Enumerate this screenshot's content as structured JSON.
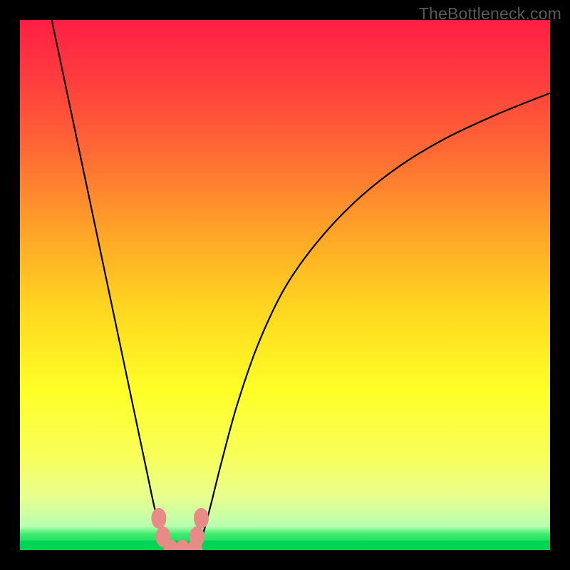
{
  "watermark": "TheBottleneck.com",
  "colors": {
    "frame": "#000000",
    "curve_stroke": "#000000",
    "marker_fill": "#e88a85",
    "marker_stroke": "#e88a85",
    "green_band": "#00d455",
    "gradient_stops": [
      {
        "offset": 0.0,
        "color": "#ff1e45"
      },
      {
        "offset": 0.12,
        "color": "#ff3f3e"
      },
      {
        "offset": 0.25,
        "color": "#ff6a34"
      },
      {
        "offset": 0.4,
        "color": "#ffa428"
      },
      {
        "offset": 0.55,
        "color": "#ffd81f"
      },
      {
        "offset": 0.7,
        "color": "#ffff27"
      },
      {
        "offset": 0.82,
        "color": "#f8ff58"
      },
      {
        "offset": 0.9,
        "color": "#e8ff8e"
      },
      {
        "offset": 0.955,
        "color": "#b8ffb0"
      },
      {
        "offset": 0.97,
        "color": "#3eea6e"
      },
      {
        "offset": 1.0,
        "color": "#00d455"
      }
    ]
  },
  "chart_data": {
    "type": "line",
    "title": "",
    "xlabel": "",
    "ylabel": "",
    "xlim": [
      0,
      1
    ],
    "ylim": [
      0,
      1
    ],
    "series": [
      {
        "name": "left-curve",
        "x": [
          0.06,
          0.08,
          0.1,
          0.12,
          0.14,
          0.16,
          0.18,
          0.2,
          0.22,
          0.24,
          0.255,
          0.268,
          0.278,
          0.285
        ],
        "y": [
          1.0,
          0.905,
          0.81,
          0.715,
          0.62,
          0.525,
          0.43,
          0.335,
          0.24,
          0.145,
          0.075,
          0.03,
          0.01,
          0.0
        ]
      },
      {
        "name": "right-curve",
        "x": [
          0.33,
          0.345,
          0.36,
          0.38,
          0.41,
          0.45,
          0.5,
          0.56,
          0.63,
          0.71,
          0.8,
          0.9,
          1.0
        ],
        "y": [
          0.0,
          0.03,
          0.085,
          0.165,
          0.275,
          0.39,
          0.495,
          0.58,
          0.655,
          0.72,
          0.775,
          0.822,
          0.862
        ]
      }
    ],
    "markers": [
      {
        "name": "left-upper",
        "x": 0.262,
        "y": 0.06
      },
      {
        "name": "left-lower",
        "x": 0.27,
        "y": 0.025
      },
      {
        "name": "right-upper",
        "x": 0.342,
        "y": 0.06
      },
      {
        "name": "right-lower",
        "x": 0.334,
        "y": 0.025
      },
      {
        "name": "bottom-left",
        "x": 0.285,
        "y": 0.0
      },
      {
        "name": "bottom-mid",
        "x": 0.307,
        "y": 0.0
      },
      {
        "name": "bottom-right",
        "x": 0.33,
        "y": 0.0
      }
    ]
  }
}
